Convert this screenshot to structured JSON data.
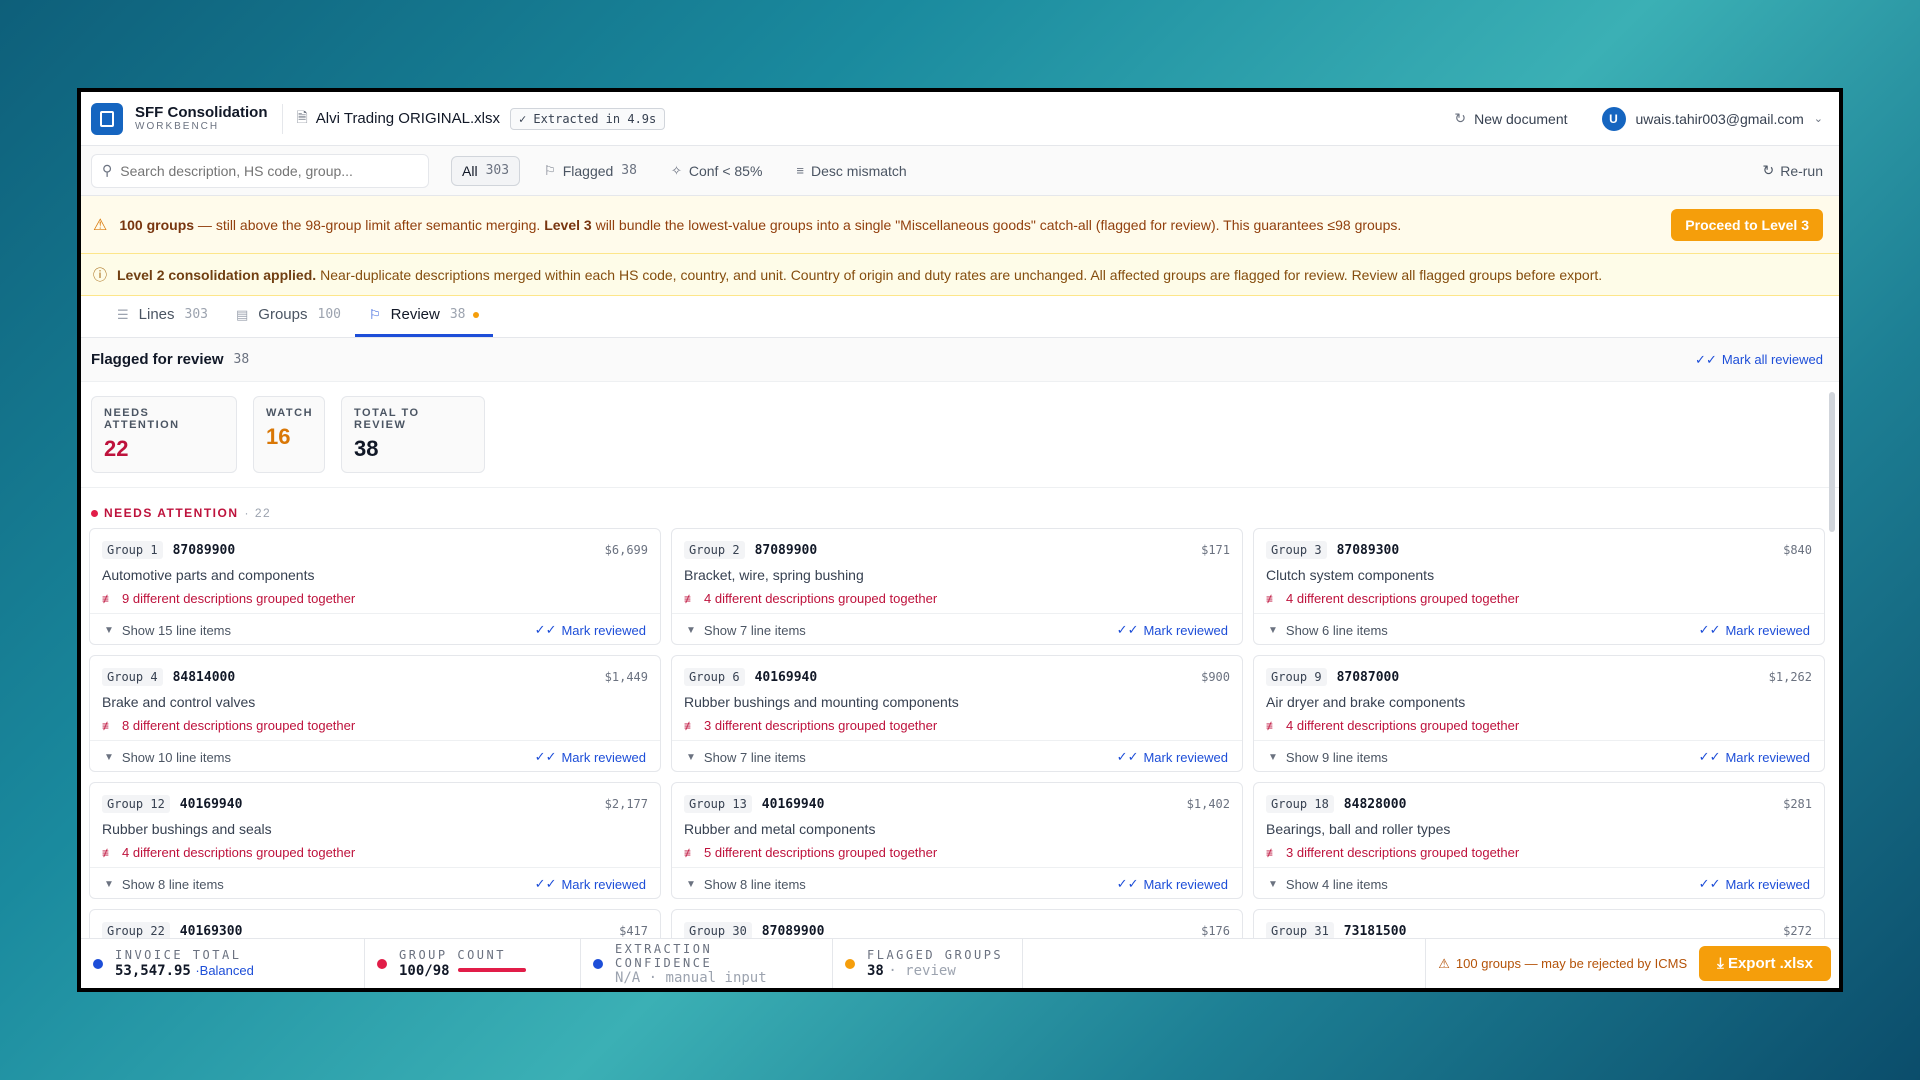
{
  "brand": {
    "title": "SFF Consolidation",
    "subtitle": "WORKBENCH"
  },
  "file": {
    "name": "Alvi Trading ORIGINAL.xlsx",
    "badge": "✓ Extracted in 4.9s"
  },
  "header": {
    "new_document": "New document",
    "user_initial": "U",
    "user_email": "uwais.tahir003@gmail.com"
  },
  "filters": {
    "search_placeholder": "Search description, HS code, group...",
    "all_label": "All",
    "all_count": "303",
    "flagged_label": "Flagged",
    "flagged_count": "38",
    "conf_label": "Conf < 85%",
    "desc_label": "Desc mismatch",
    "rerun": "Re-run"
  },
  "warning": {
    "bold1": "100 groups",
    "text1": " — still above the 98-group limit after semantic merging. ",
    "bold2": "Level 3",
    "text2": " will bundle the lowest-value groups into a single \"Miscellaneous goods\" catch-all (flagged for review). This guarantees ≤98 groups.",
    "button": "Proceed to Level 3"
  },
  "info": {
    "bold": "Level 2 consolidation applied.",
    "text": "Near-duplicate descriptions merged within each HS code, country, and unit. Country of origin and duty rates are unchanged. All affected groups are flagged for review. Review all flagged groups before export."
  },
  "tabs": [
    {
      "label": "Lines",
      "count": "303"
    },
    {
      "label": "Groups",
      "count": "100"
    },
    {
      "label": "Review",
      "count": "38"
    }
  ],
  "review": {
    "title": "Flagged for review",
    "count": "38",
    "mark_all": "Mark all reviewed",
    "stats": [
      {
        "label": "NEEDS ATTENTION",
        "value": "22",
        "color": "#be123c"
      },
      {
        "label": "WATCH",
        "value": "16",
        "color": "#d97706"
      },
      {
        "label": "TOTAL TO REVIEW",
        "value": "38",
        "color": "#111827"
      }
    ],
    "section_label": "NEEDS ATTENTION",
    "section_count": "· 22",
    "mark_reviewed": "Mark reviewed",
    "cards": [
      {
        "group": "Group 1",
        "hs": "87089900",
        "amount": "$6,699",
        "desc": "Automotive parts and components",
        "dd": "9 different descriptions grouped together",
        "show": "Show 15 line items"
      },
      {
        "group": "Group 2",
        "hs": "87089900",
        "amount": "$171",
        "desc": "Bracket, wire, spring bushing",
        "dd": "4 different descriptions grouped together",
        "show": "Show 7 line items"
      },
      {
        "group": "Group 3",
        "hs": "87089300",
        "amount": "$840",
        "desc": "Clutch system components",
        "dd": "4 different descriptions grouped together",
        "show": "Show 6 line items"
      },
      {
        "group": "Group 4",
        "hs": "84814000",
        "amount": "$1,449",
        "desc": "Brake and control valves",
        "dd": "8 different descriptions grouped together",
        "show": "Show 10 line items"
      },
      {
        "group": "Group 6",
        "hs": "40169940",
        "amount": "$900",
        "desc": "Rubber bushings and mounting components",
        "dd": "3 different descriptions grouped together",
        "show": "Show 7 line items"
      },
      {
        "group": "Group 9",
        "hs": "87087000",
        "amount": "$1,262",
        "desc": "Air dryer and brake components",
        "dd": "4 different descriptions grouped together",
        "show": "Show 9 line items"
      },
      {
        "group": "Group 12",
        "hs": "40169940",
        "amount": "$2,177",
        "desc": "Rubber bushings and seals",
        "dd": "4 different descriptions grouped together",
        "show": "Show 8 line items"
      },
      {
        "group": "Group 13",
        "hs": "40169940",
        "amount": "$1,402",
        "desc": "Rubber and metal components",
        "dd": "5 different descriptions grouped together",
        "show": "Show 8 line items"
      },
      {
        "group": "Group 18",
        "hs": "84828000",
        "amount": "$281",
        "desc": "Bearings, ball and roller types",
        "dd": "3 different descriptions grouped together",
        "show": "Show 4 line items"
      },
      {
        "group": "Group 22",
        "hs": "40169300",
        "amount": "$417",
        "desc": "",
        "dd": "",
        "show": ""
      },
      {
        "group": "Group 30",
        "hs": "87089900",
        "amount": "$176",
        "desc": "",
        "dd": "",
        "show": ""
      },
      {
        "group": "Group 31",
        "hs": "73181500",
        "amount": "$272",
        "desc": "",
        "dd": "",
        "show": ""
      }
    ]
  },
  "footer": {
    "invoice_label": "INVOICE TOTAL",
    "invoice_value": "53,547.95",
    "invoice_sub": "·Balanced",
    "group_label": "GROUP COUNT",
    "group_value": "100/98",
    "group_fill": 1.0,
    "conf_label": "EXTRACTION CONFIDENCE",
    "conf_value": "N/A · manual input",
    "flagged_label": "FLAGGED GROUPS",
    "flagged_value": "38",
    "flagged_sub": "· review",
    "warn": "100 groups — may be rejected by ICMS",
    "export": "Export .xlsx"
  },
  "colors": {
    "accent": "#1d4ed8",
    "brand": "#1565c0",
    "danger": "#be123c",
    "warn": "#f59e0b"
  }
}
